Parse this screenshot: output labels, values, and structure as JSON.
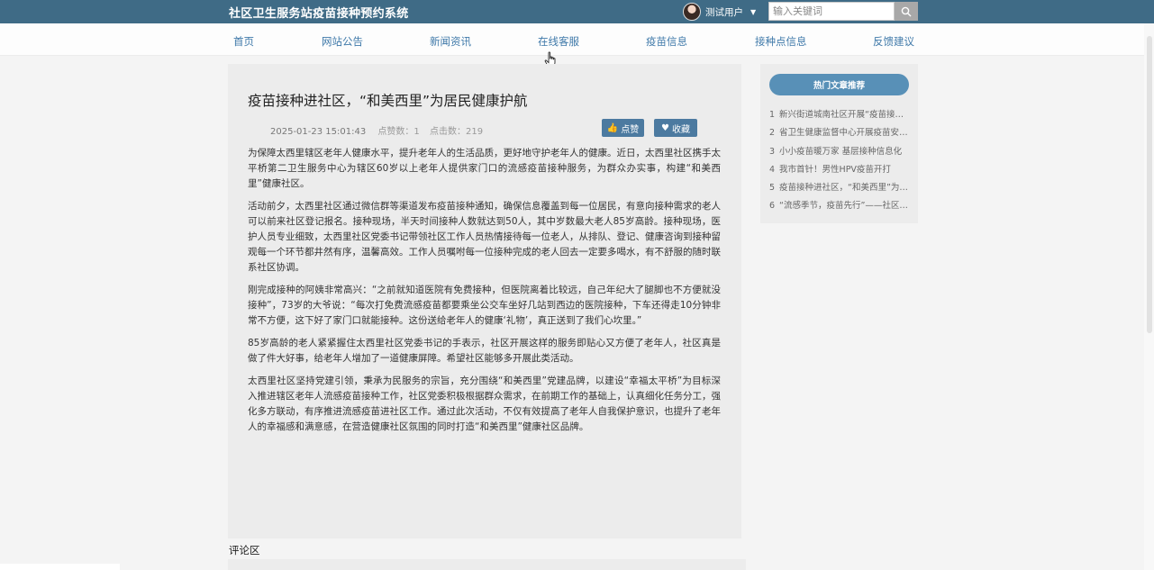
{
  "header": {
    "site_title": "社区卫生服务站疫苗接种预约系统",
    "user_name": "测试用户",
    "search_placeholder": "输入关键词"
  },
  "nav": {
    "items": [
      {
        "label": "首页"
      },
      {
        "label": "网站公告"
      },
      {
        "label": "新闻资讯"
      },
      {
        "label": "在线客服"
      },
      {
        "label": "疫苗信息"
      },
      {
        "label": "接种点信息"
      },
      {
        "label": "反馈建议"
      }
    ]
  },
  "article": {
    "title": "疫苗接种进社区，“和美西里”为居民健康护航",
    "date": "2025-01-23 15:01:43",
    "likes": "点赞数：1",
    "clicks": "点击数：219",
    "like_label": "点赞",
    "favorite_label": "收藏",
    "paragraphs": [
      "为保障太西里辖区老年人健康水平，提升老年人的生活品质，更好地守护老年人的健康。近日，太西里社区携手太平桥第二卫生服务中心为辖区60岁以上老年人提供家门口的流感疫苗接种服务，为群众办实事，构建“和美西里”健康社区。",
      "活动前夕，太西里社区通过微信群等渠道发布疫苗接种通知，确保信息覆盖到每一位居民，有意向接种需求的老人可以前来社区登记报名。接种现场，半天时间接种人数就达到50人，其中岁数最大老人85岁高龄。接种现场，医护人员专业细致，太西里社区党委书记带领社区工作人员热情接待每一位老人，从排队、登记、健康咨询到接种留观每一个环节都井然有序，温馨高效。工作人员嘱咐每一位接种完成的老人回去一定要多喝水，有不舒服的随时联系社区协调。",
      "刚完成接种的阿姨非常高兴：“之前就知道医院有免费接种，但医院离着比较远，自己年纪大了腿脚也不方便就没接种”，73岁的大爷说：“每次打免费流感疫苗都要乘坐公交车坐好几站到西边的医院接种，下车还得走10分钟非常不方便，这下好了家门口就能接种。这份送给老年人的健康‘礼物’，真正送到了我们心坎里。”",
      "85岁高龄的老人紧紧握住太西里社区党委书记的手表示，社区开展这样的服务即贴心又方便了老年人，社区真是做了件大好事，给老年人增加了一道健康屏障。希望社区能够多开展此类活动。",
      "太西里社区坚持党建引领，秉承为民服务的宗旨，充分围绕“和美西里”党建品牌，以建设“幸福太平桥”为目标深入推进辖区老年人流感疫苗接种工作，社区党委积极根据群众需求，在前期工作的基础上，认真细化任务分工，强化多方联动，有序推进流感疫苗进社区工作。通过此次活动，不仅有效提高了老年人自我保护意识，也提升了老年人的幸福感和满意感，在营造健康社区氛围的同时打造“和美西里”健康社区品牌。"
    ]
  },
  "sidebar": {
    "heading": "热门文章推荐",
    "items": [
      {
        "num": "1",
        "title": "新兴街道城南社区开展“疫苗接种进社区”活动"
      },
      {
        "num": "2",
        "title": "省卫生健康监督中心开展疫苗安全检查"
      },
      {
        "num": "3",
        "title": "小小疫苗暖万家 基层接种信息化"
      },
      {
        "num": "4",
        "title": "我市首针！男性HPV疫苗开打"
      },
      {
        "num": "5",
        "title": "疫苗接种进社区，“和美西里”为居民健康护航"
      },
      {
        "num": "6",
        "title": "“流感季节，疫苗先行”——社区接种活动"
      }
    ]
  },
  "comments": {
    "label": "评论区"
  },
  "colors": {
    "topbar": "#3f6b86",
    "nav_link": "#3f79a9",
    "button": "#4c7aa0",
    "hot_button": "#5890b7"
  }
}
